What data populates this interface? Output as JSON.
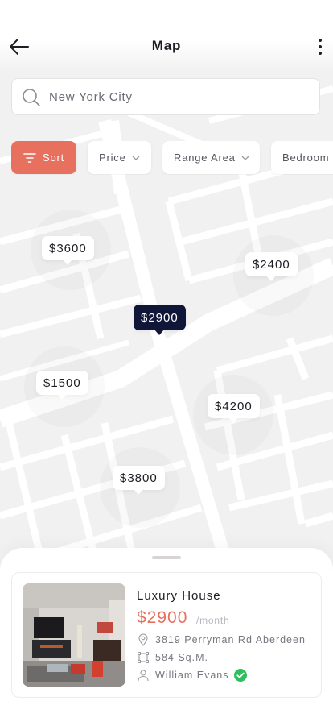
{
  "header": {
    "title": "Map"
  },
  "search": {
    "placeholder": "New York City"
  },
  "filters": {
    "sort_label": "Sort",
    "chips": [
      "Price",
      "Range Area",
      "Bedroom"
    ]
  },
  "markers": [
    "$3600",
    "$2400",
    "$2900",
    "$1500",
    "$4200",
    "$3800"
  ],
  "listing": {
    "title": "Luxury House",
    "price": "$2900",
    "price_unit": "/month",
    "address": "3819 Perryman Rd Aberdeen",
    "area": "584 Sq.M.",
    "agent": "William Evans"
  },
  "colors": {
    "accent": "#e8705e",
    "marker_active": "#0f1638",
    "verified": "#2cbf5b"
  }
}
